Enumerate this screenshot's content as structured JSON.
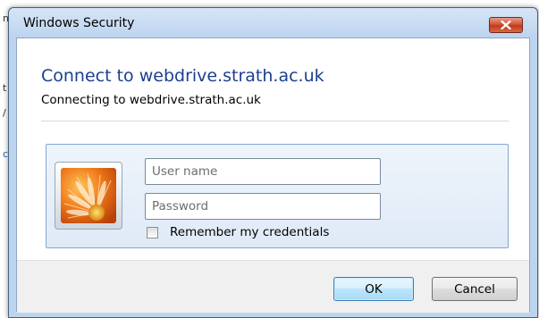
{
  "window": {
    "title": "Windows Security"
  },
  "dialog": {
    "heading": "Connect to webdrive.strath.ac.uk",
    "subheading": "Connecting to webdrive.strath.ac.uk"
  },
  "credentials": {
    "username_placeholder": "User name",
    "password_placeholder": "Password",
    "remember_label": "Remember my credentials",
    "remember_checked": false
  },
  "buttons": {
    "ok_label": "OK",
    "cancel_label": "Cancel"
  },
  "icons": {
    "close": "close-icon",
    "user_tile": "user-tile-flower-icon"
  },
  "colors": {
    "heading": "#1c3f94",
    "close_button": "#c23a1c",
    "frame": "#bdd4ee"
  },
  "background": {
    "fragments": [
      "n",
      "t",
      "/",
      "c"
    ]
  }
}
